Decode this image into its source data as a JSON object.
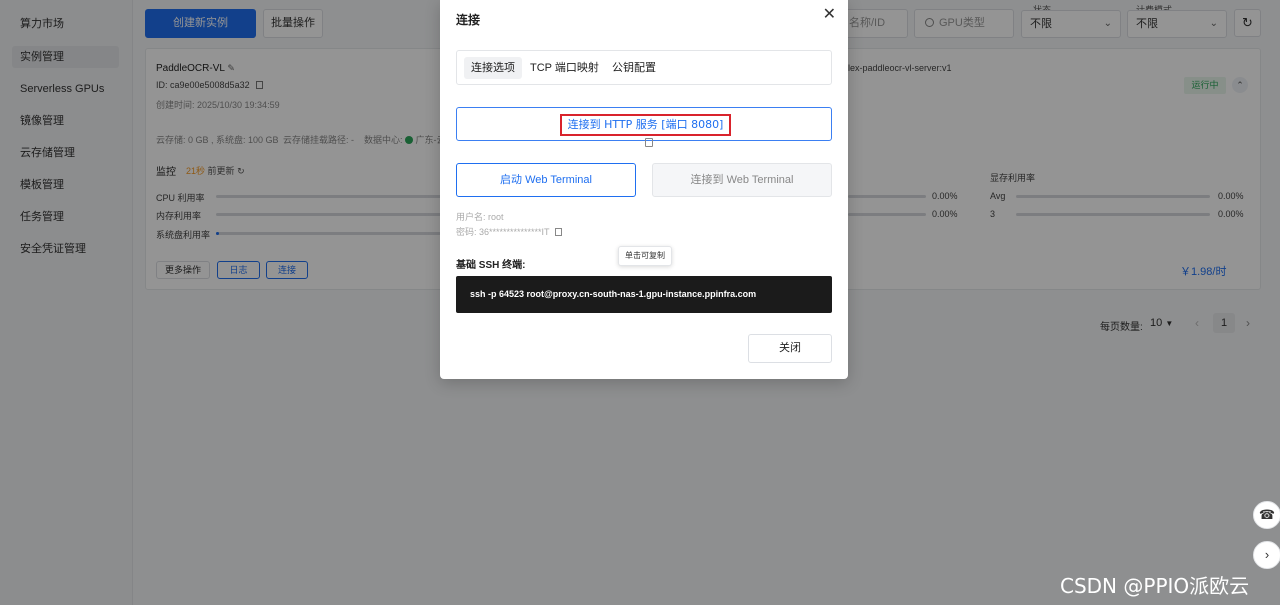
{
  "sidebar": {
    "items": [
      {
        "label": "算力市场"
      },
      {
        "label": "实例管理"
      },
      {
        "label": "Serverless GPUs"
      },
      {
        "label": "镜像管理"
      },
      {
        "label": "云存储管理"
      },
      {
        "label": "模板管理"
      },
      {
        "label": "任务管理"
      },
      {
        "label": "安全凭证管理"
      }
    ]
  },
  "toolbar": {
    "create_label": "创建新实例",
    "batch_label": "批量操作",
    "name_placeholder": "名称/ID",
    "gpu_placeholder": "GPU类型",
    "status_label": "状态",
    "status_value": "不限",
    "billing_label": "计费模式",
    "billing_value": "不限"
  },
  "instance": {
    "name": "PaddleOCR-VL",
    "id": "ID: ca9e00e5008d5a32",
    "created": "创建时间: 2025/10/30 19:34:59",
    "image": "lex-paddleocr-vl-server:v1",
    "status": "运行中",
    "storage": "云存储: 0 GB , 系统盘: 100 GB",
    "mount": "云存储挂载路径: -",
    "datacenter": "数据中心:",
    "datacenter_value": "广东-云",
    "monitor_label": "监控",
    "monitor_time": "21秒",
    "monitor_suffix": "前更新",
    "cpu_label": "CPU 利用率",
    "mem_label": "内存利用率",
    "disk_label": "系统盘利用率",
    "right_pct1": "0.00%",
    "right_pct2": "0.00%",
    "gpu_mem_label": "显存利用率",
    "gpu_avg_label": "Avg",
    "gpu_avg_pct": "0.00%",
    "gpu_3_label": "3",
    "gpu_3_pct": "0.00%",
    "more_label": "更多操作",
    "log_label": "日志",
    "connect_label": "连接",
    "price": "￥1.98/时"
  },
  "pagination": {
    "per_page_label": "每页数量:",
    "per_page_value": "10",
    "current_page": "1"
  },
  "modal": {
    "title": "连接",
    "tabs": [
      {
        "label": "连接选项"
      },
      {
        "label": "TCP 端口映射"
      },
      {
        "label": "公钥配置"
      }
    ],
    "http_button": "连接到 HTTP 服务 [端口 8080]",
    "start_terminal": "启动 Web Terminal",
    "connect_terminal": "连接到 Web Terminal",
    "username": "用户名: root",
    "password": "密码: 36***************IT",
    "ssh_label": "基础 SSH 终端:",
    "tooltip": "单击可复制",
    "ssh_command": "ssh -p 64523 root@proxy.cn-south-nas-1.gpu-instance.ppinfra.com",
    "close_button": "关闭"
  },
  "watermark": "CSDN @PPIO派欧云",
  "colors": {
    "primary": "#1f6ff0",
    "highlight_border": "#d9232c",
    "running_bg": "#e8f6ec",
    "running_text": "#2ba65a",
    "orange": "#f59a23"
  }
}
